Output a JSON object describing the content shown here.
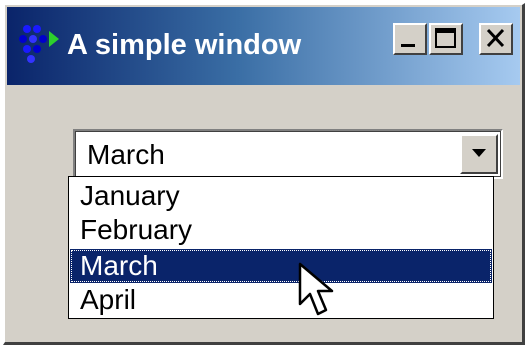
{
  "window": {
    "title": "A simple window",
    "icon": "app-icon",
    "buttons": [
      "minimize",
      "maximize",
      "close"
    ]
  },
  "colors": {
    "titlebar_start": "#0a246a",
    "titlebar_end": "#a6caf0",
    "face": "#d4d0c8",
    "selection": "#0a246a"
  },
  "combo": {
    "value": "March",
    "options": [
      {
        "label": "January",
        "selected": false
      },
      {
        "label": "February",
        "selected": false
      },
      {
        "label": "March",
        "selected": true
      },
      {
        "label": "April",
        "selected": false
      }
    ]
  },
  "cursor": "arrow-cursor-icon"
}
